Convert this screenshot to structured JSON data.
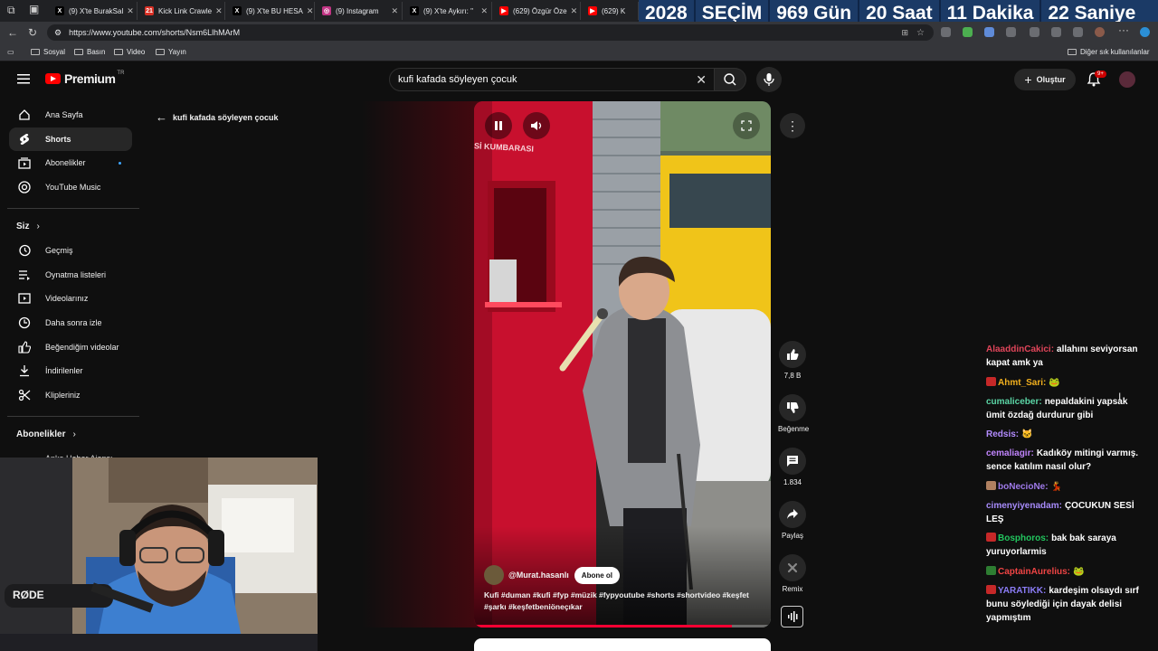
{
  "browser": {
    "tabs": [
      {
        "title": "(9) X'te BurakSal",
        "color": "#000000",
        "glyph": "X"
      },
      {
        "title": "Kick Link Crawle",
        "color": "#d93025",
        "glyph": "21"
      },
      {
        "title": "(9) X'te BU HESA",
        "color": "#000000",
        "glyph": "X"
      },
      {
        "title": "(9) Instagram",
        "color": "#c13584",
        "glyph": "◎"
      },
      {
        "title": "(9) X'te Aykırı: \"",
        "color": "#000000",
        "glyph": "X"
      },
      {
        "title": "(629) Özgür Öze",
        "color": "#ff0000",
        "glyph": "▶"
      },
      {
        "title": "(629) K",
        "color": "#ff0000",
        "glyph": "▶"
      }
    ],
    "url": "https://www.youtube.com/shorts/Nsm6LlhMArM",
    "bookmarks": [
      "Sosyal",
      "Basın",
      "Video",
      "Yayın"
    ],
    "other_bookmarks": "Diğer sık kullanılanlar"
  },
  "countdown": {
    "year": "2028",
    "label": "SEÇİM",
    "days": "969 Gün",
    "hours": "20 Saat",
    "minutes": "11 Dakika",
    "seconds": "22 Saniye"
  },
  "youtube": {
    "logo_text": "Premium",
    "logo_region": "TR",
    "search_query": "kufi kafada söyleyen çocuk",
    "create_label": "Oluştur",
    "notif_count": "9+"
  },
  "sidebar": {
    "main": [
      {
        "label": "Ana Sayfa",
        "icon": "home-icon"
      },
      {
        "label": "Shorts",
        "icon": "shorts-icon"
      },
      {
        "label": "Abonelikler",
        "icon": "subscriptions-icon"
      },
      {
        "label": "YouTube Music",
        "icon": "music-icon"
      }
    ],
    "you_heading": "Siz",
    "you": [
      {
        "label": "Geçmiş",
        "icon": "history-icon"
      },
      {
        "label": "Oynatma listeleri",
        "icon": "playlist-icon"
      },
      {
        "label": "Videolarınız",
        "icon": "your-videos-icon"
      },
      {
        "label": "Daha sonra izle",
        "icon": "watch-later-icon"
      },
      {
        "label": "Beğendiğim videolar",
        "icon": "liked-icon"
      },
      {
        "label": "İndirilenler",
        "icon": "downloads-icon"
      },
      {
        "label": "Klipleriniz",
        "icon": "clips-icon"
      }
    ],
    "subs_heading": "Abonelikler",
    "subs_partial": "Anka Haber Ajansı"
  },
  "back_link": "kufi kafada söyleyen çocuk",
  "short": {
    "channel": "@Murat.hasanlı",
    "subscribe_label": "Abone ol",
    "caption": "Kufi #duman #kufi #fyp #müzik #fypyoutube #shorts #shortvideo #keşfet #şarkı #keşfetbeniöneçıkar",
    "kiosk_text": "Sİ KUMBARASI",
    "progress": 0.87
  },
  "actions": {
    "likes": "7,8 B",
    "dislike_label": "Beğenme",
    "comments": "1.834",
    "share_label": "Paylaş",
    "remix_label": "Remix"
  },
  "chat": [
    {
      "user": "AlaaddinCakici:",
      "color": "#e0455a",
      "text": "allahını seviyorsan kapat amk ya"
    },
    {
      "user": "Ahmt_Sari:",
      "color": "#f2b01e",
      "text": "🐸",
      "badge": "#c62828"
    },
    {
      "user": "cumaliceber:",
      "color": "#5bd6a6",
      "text": "nepaldakini yapsak ümit özdağ durdurur gibi"
    },
    {
      "user": "Redsis:",
      "color": "#b38cff",
      "text": "🐱"
    },
    {
      "user": "cemaliagir:",
      "color": "#c084fc",
      "text": "Kadıköy mitingi varmış. sence katılım nasıl olur?"
    },
    {
      "user": "boNecioNe:",
      "color": "#9f7aea",
      "text": "💃",
      "badge": "#b08060"
    },
    {
      "user": "cimenyiyenadam:",
      "color": "#a78bfa",
      "text": "ÇOCUKUN SESİ LEŞ"
    },
    {
      "user": "Bosphoros:",
      "color": "#22c55e",
      "text": "bak bak saraya yuruyorlarmis",
      "badge": "#c62828"
    },
    {
      "user": "CaptainAurelius:",
      "color": "#ef4444",
      "text": "🐸",
      "badge": "#2e7d32"
    },
    {
      "user": "YARATIKK:",
      "color": "#8b7cf6",
      "text": "kardeşim olsaydı sırf bunu söylediği için dayak delisi yapmıştım",
      "badge": "#c62828"
    }
  ],
  "webcam": {
    "brand": "RØDE"
  }
}
